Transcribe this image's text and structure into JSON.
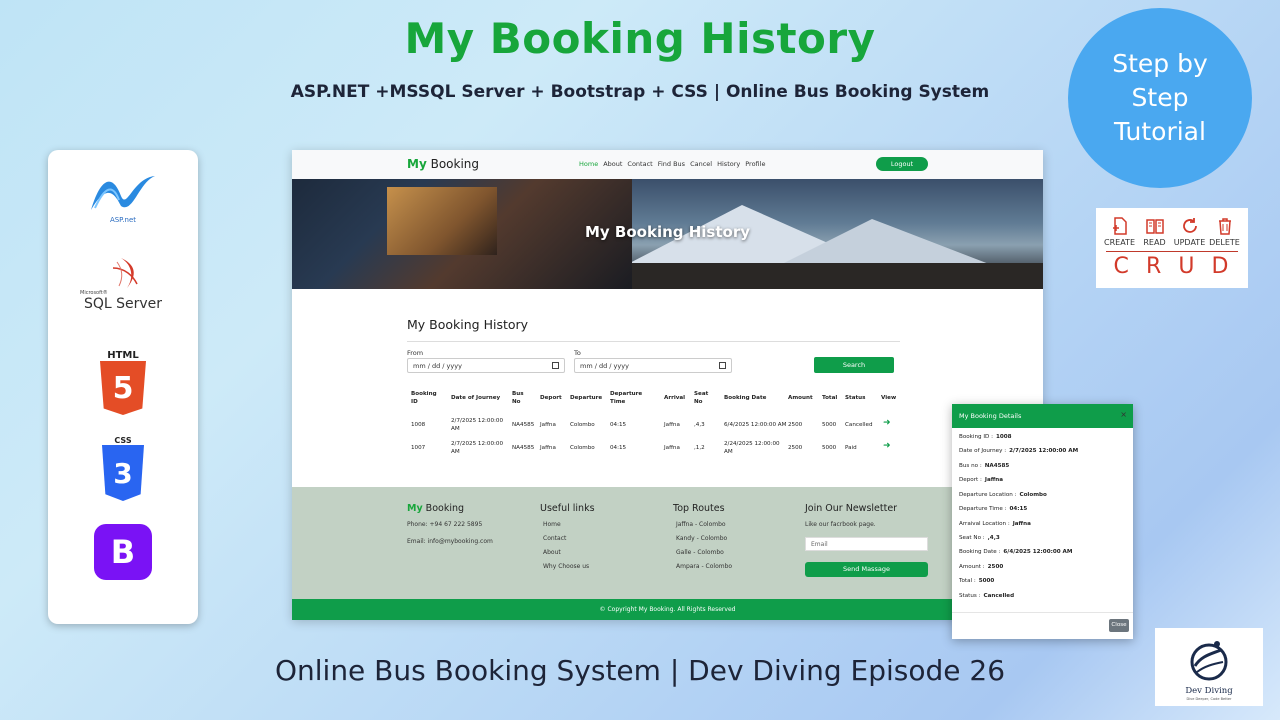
{
  "header": {
    "title": "My Booking History",
    "subtitle": "ASP.NET +MSSQL Server + Bootstrap + CSS | Online Bus Booking System",
    "bottom": "Online Bus Booking System | Dev Diving Episode 26"
  },
  "badge": {
    "line1": "Step by",
    "line2": "Step",
    "line3": "Tutorial",
    "color": "#4aa8f0"
  },
  "crud": {
    "labels": [
      "CREATE",
      "READ",
      "UPDATE",
      "DELETE"
    ],
    "letters": [
      "C",
      "R",
      "U",
      "D"
    ],
    "color": "#d23a2a"
  },
  "tech": {
    "aspnet_label": "ASP.net",
    "sql_small": "Microsoft®",
    "sql_label": "SQL Server",
    "html_label": "HTML",
    "html_num": "5",
    "css_label": "CSS",
    "css_num": "3",
    "bootstrap_letter": "B"
  },
  "site": {
    "brand_accent": "My",
    "brand_rest": " Booking",
    "nav": [
      "Home",
      "About",
      "Contact",
      "Find Bus",
      "Cancel",
      "History",
      "Profile"
    ],
    "logout": "Logout",
    "hero_title": "My Booking History",
    "page_heading": "My Booking History",
    "from_label": "From",
    "to_label": "To",
    "date_placeholder": "mm / dd / yyyy",
    "search": "Search",
    "columns": [
      [
        "Booking",
        "ID"
      ],
      [
        "Date of Journey",
        ""
      ],
      [
        "Bus",
        "No"
      ],
      [
        "Deport",
        ""
      ],
      [
        "Departure",
        ""
      ],
      [
        "Departure",
        "Time"
      ],
      [
        "Arrival",
        ""
      ],
      [
        "Seat",
        "No"
      ],
      [
        "Booking Date",
        ""
      ],
      [
        "Amount",
        ""
      ],
      [
        "Total",
        ""
      ],
      [
        "Status",
        ""
      ],
      [
        "View",
        ""
      ]
    ],
    "rows": [
      {
        "id": "1008",
        "doj1": "2/7/2025 12:00:00",
        "doj2": "AM",
        "bus": "NA4585",
        "deport": "Jaffna",
        "departure": "Colombo",
        "dep_time": "04:15",
        "arrival": "Jaffna",
        "seat": ",4,3",
        "bdate": "6/4/2025 12:00:00 AM",
        "bdate2": "",
        "amount": "2500",
        "total": "5000",
        "status": "Cancelled"
      },
      {
        "id": "1007",
        "doj1": "2/7/2025 12:00:00",
        "doj2": "AM",
        "bus": "NA4585",
        "deport": "Jaffna",
        "departure": "Colombo",
        "dep_time": "04:15",
        "arrival": "Jaffna",
        "seat": ",1,2",
        "bdate": "2/24/2025 12:00:00",
        "bdate2": "AM",
        "amount": "2500",
        "total": "5000",
        "status": "Paid"
      }
    ],
    "footer": {
      "brand_accent": "My",
      "brand_rest": " Booking",
      "phone": "Phone: +94 67 222 5895",
      "email": "Email: info@mybooking.com",
      "useful_title": "Useful links",
      "useful": [
        "Home",
        "Contact",
        "About",
        "Why Choose us"
      ],
      "routes_title": "Top Routes",
      "routes": [
        "Jaffna - Colombo",
        "Kandy - Colombo",
        "Galle - Colombo",
        "Ampara - Colombo"
      ],
      "newsletter_title": "Join Our Newsletter",
      "newsletter_text": "Like our facrbook page.",
      "email_placeholder": "Email",
      "send": "Send Massage",
      "copyright": "© Copyright My Booking. All Rights Reserved"
    }
  },
  "modal": {
    "title": "My Booking Details",
    "close_x": "×",
    "fields": [
      {
        "label": "Booking ID :",
        "value": "1008"
      },
      {
        "label": "Date of Journey :",
        "value": "2/7/2025 12:00:00 AM"
      },
      {
        "label": "Bus no :",
        "value": "NA4585"
      },
      {
        "label": "Deport :",
        "value": "Jaffna"
      },
      {
        "label": "Departure Location :",
        "value": "Colombo"
      },
      {
        "label": "Departure Time :",
        "value": "04:15"
      },
      {
        "label": "Arraival Location :",
        "value": "Jaffna"
      },
      {
        "label": "Seat No :",
        "value": ",4,3"
      },
      {
        "label": "Booking Date :",
        "value": "6/4/2025 12:00:00 AM"
      },
      {
        "label": "Amount :",
        "value": "2500"
      },
      {
        "label": "Total :",
        "value": "5000"
      },
      {
        "label": "Status :",
        "value": "Cancelled"
      }
    ],
    "close": "Close"
  },
  "logo": {
    "name": "Dev Diving",
    "tagline": "Dive Deeper, Code Better"
  },
  "colors": {
    "green": "#17a63b",
    "button_green": "#0f9d4a",
    "footer_bg": "#c2d1c4"
  }
}
